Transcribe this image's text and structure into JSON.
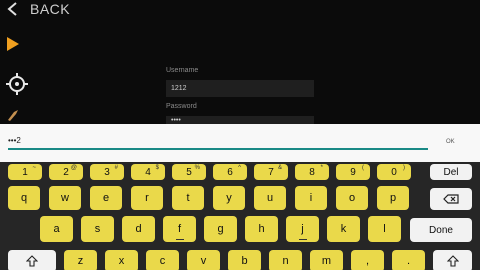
{
  "header": {
    "back_label": "BACK"
  },
  "form": {
    "username_label": "Username",
    "username_value": "1212",
    "password_label": "Password",
    "password_value": "••••"
  },
  "input_bar": {
    "text": "•••2",
    "ok_label": "OK"
  },
  "keyboard": {
    "number_row": [
      {
        "main": "1",
        "sup": "~"
      },
      {
        "main": "2",
        "sup": "@"
      },
      {
        "main": "3",
        "sup": "#"
      },
      {
        "main": "4",
        "sup": "$"
      },
      {
        "main": "5",
        "sup": "%"
      },
      {
        "main": "6",
        "sup": "^"
      },
      {
        "main": "7",
        "sup": "&"
      },
      {
        "main": "8",
        "sup": "*"
      },
      {
        "main": "9",
        "sup": "("
      },
      {
        "main": "0",
        "sup": ")"
      }
    ],
    "del_label": "Del",
    "row2": [
      "q",
      "w",
      "e",
      "r",
      "t",
      "y",
      "u",
      "i",
      "o",
      "p"
    ],
    "row3": [
      "a",
      "s",
      "d",
      "f",
      "g",
      "h",
      "j",
      "k",
      "l"
    ],
    "row4": [
      "z",
      "x",
      "c",
      "v",
      "b",
      "n",
      "m",
      ",",
      "."
    ],
    "done_label": "Done",
    "accent_yellow": "#ead94a",
    "accent_teal": "#1a8a86"
  }
}
